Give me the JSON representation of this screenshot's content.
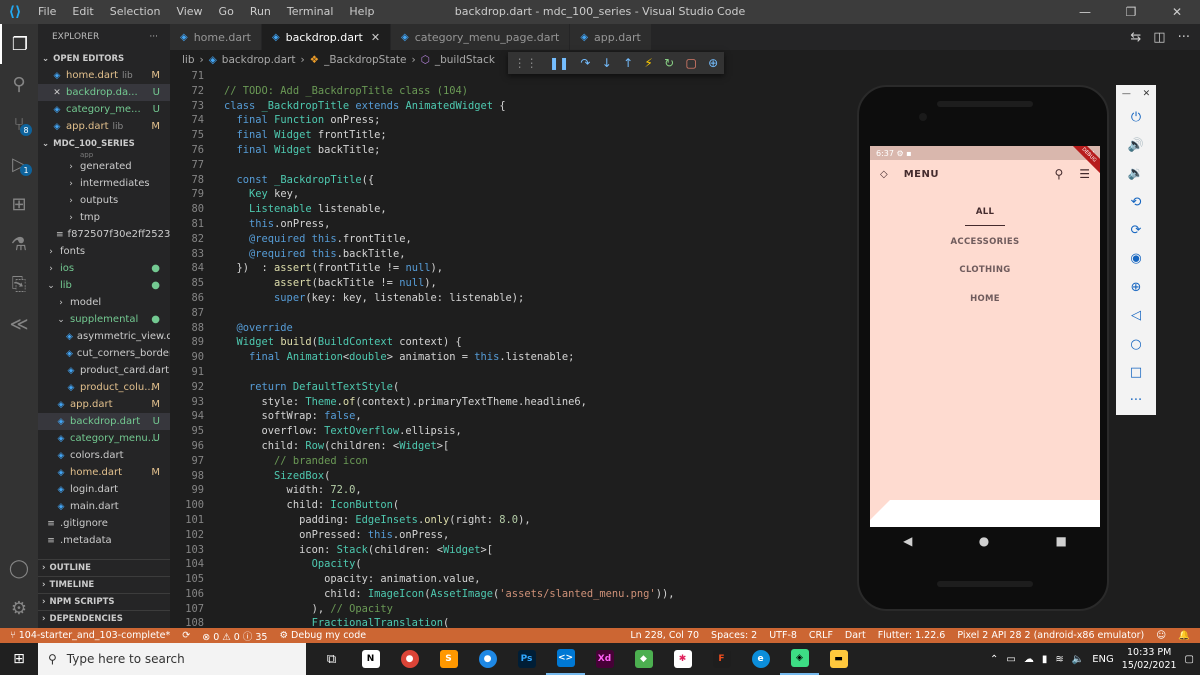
{
  "titlebar": {
    "menu": [
      "File",
      "Edit",
      "Selection",
      "View",
      "Go",
      "Run",
      "Terminal",
      "Help"
    ],
    "title": "backdrop.dart - mdc_100_series - Visual Studio Code",
    "minimize": "—",
    "restore": "❐",
    "close": "✕"
  },
  "sidebar": {
    "title": "EXPLORER",
    "more": "···",
    "open_editors_label": "OPEN EDITORS",
    "open_editors": [
      {
        "name": "home.dart",
        "path": "lib",
        "status": "M"
      },
      {
        "name": "backdrop.da...",
        "path": "",
        "status": "U"
      },
      {
        "name": "category_me...",
        "path": "",
        "status": "U"
      },
      {
        "name": "app.dart",
        "path": "lib",
        "status": "M"
      }
    ],
    "project_label": "MDC_100_SERIES",
    "tree": [
      {
        "label": "app",
        "indent": 2,
        "kind": "partial",
        "status": ""
      },
      {
        "label": "generated",
        "indent": 2,
        "kind": "folder",
        "status": ""
      },
      {
        "label": "intermediates",
        "indent": 2,
        "kind": "folder",
        "status": ""
      },
      {
        "label": "outputs",
        "indent": 2,
        "kind": "folder",
        "status": ""
      },
      {
        "label": "tmp",
        "indent": 2,
        "kind": "folder",
        "status": ""
      },
      {
        "label": "f872507f30e2ff2523f...",
        "indent": 1,
        "kind": "file",
        "status": ""
      },
      {
        "label": "fonts",
        "indent": 0,
        "kind": "folder",
        "status": ""
      },
      {
        "label": "ios",
        "indent": 0,
        "kind": "folder",
        "status": "●"
      },
      {
        "label": "lib",
        "indent": 0,
        "kind": "folder-open",
        "status": "●"
      },
      {
        "label": "model",
        "indent": 1,
        "kind": "folder",
        "status": ""
      },
      {
        "label": "supplemental",
        "indent": 1,
        "kind": "folder-open",
        "status": "●"
      },
      {
        "label": "asymmetric_view.d...",
        "indent": 2,
        "kind": "dart",
        "status": ""
      },
      {
        "label": "cut_corners_border...",
        "indent": 2,
        "kind": "dart",
        "status": ""
      },
      {
        "label": "product_card.dart",
        "indent": 2,
        "kind": "dart",
        "status": ""
      },
      {
        "label": "product_colu...",
        "indent": 2,
        "kind": "dart",
        "status": "M"
      },
      {
        "label": "app.dart",
        "indent": 1,
        "kind": "dart",
        "status": "M"
      },
      {
        "label": "backdrop.dart",
        "indent": 1,
        "kind": "dart",
        "status": "U"
      },
      {
        "label": "category_menu...",
        "indent": 1,
        "kind": "dart",
        "status": "U"
      },
      {
        "label": "colors.dart",
        "indent": 1,
        "kind": "dart",
        "status": ""
      },
      {
        "label": "home.dart",
        "indent": 1,
        "kind": "dart",
        "status": "M"
      },
      {
        "label": "login.dart",
        "indent": 1,
        "kind": "dart",
        "status": ""
      },
      {
        "label": "main.dart",
        "indent": 1,
        "kind": "dart",
        "status": ""
      },
      {
        "label": ".gitignore",
        "indent": 0,
        "kind": "file",
        "status": ""
      },
      {
        "label": ".metadata",
        "indent": 0,
        "kind": "file",
        "status": ""
      }
    ],
    "bottom_sections": [
      "OUTLINE",
      "TIMELINE",
      "NPM SCRIPTS",
      "DEPENDENCIES"
    ]
  },
  "tabs": [
    {
      "label": "home.dart",
      "active": false
    },
    {
      "label": "backdrop.dart",
      "active": true
    },
    {
      "label": "category_menu_page.dart",
      "active": false
    },
    {
      "label": "app.dart",
      "active": false
    }
  ],
  "breadcrumb": [
    "lib",
    "backdrop.dart",
    "_BackdropState",
    "_buildStack"
  ],
  "editor": {
    "line_numbers": [
      "71",
      "72",
      "73",
      "74",
      "75",
      "76",
      "77",
      "78",
      "79",
      "80",
      "81",
      "82",
      "83",
      "84",
      "85",
      "86",
      "87",
      "88",
      "89",
      "90",
      "91",
      "92",
      "93",
      "94",
      "95",
      "96",
      "97",
      "98",
      "99",
      "100",
      "101",
      "102",
      "103",
      "104",
      "105",
      "106",
      "107",
      "108"
    ]
  },
  "emulator": {
    "time": "6:37",
    "debug_band": "DEBUG",
    "appbar_title": "MENU",
    "categories": [
      "ALL",
      "ACCESSORIES",
      "CLOTHING",
      "HOME"
    ],
    "active_category": "ALL"
  },
  "statusbar": {
    "branch": "104-starter_and_103-complete*",
    "errors": "0",
    "warnings": "0",
    "info": "35",
    "debug": "Debug my code",
    "position": "Ln 228, Col 70",
    "spaces": "Spaces: 2",
    "encoding": "UTF-8",
    "eol": "CRLF",
    "language": "Dart",
    "flutter": "Flutter: 1.22.6",
    "device": "Pixel 2 API 28 2 (android-x86 emulator)"
  },
  "taskbar": {
    "search_placeholder": "Type here to search",
    "lang": "ENG",
    "time": "10:33 PM",
    "date": "15/02/2021"
  },
  "colors": {
    "accent": "#cc6633",
    "emulator_bg": "#fedbd0",
    "brand_text": "#442b2d"
  }
}
